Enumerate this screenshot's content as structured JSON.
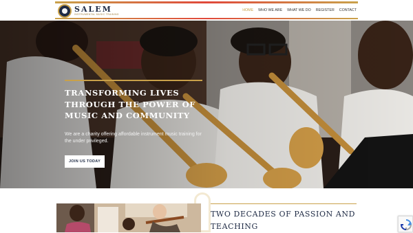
{
  "header": {
    "brand_name": "SALEM",
    "brand_tagline": "INSTRUMENTAL MUSIC TRAINING",
    "nav": [
      {
        "label": "HOME",
        "active": true
      },
      {
        "label": "WHO WE ARE",
        "active": false
      },
      {
        "label": "WHAT WE DO",
        "active": false
      },
      {
        "label": "REGISTER",
        "active": false
      },
      {
        "label": "CONTACT",
        "active": false
      }
    ],
    "colors": {
      "accent": "#c9a14a",
      "brand": "#1e2a44",
      "stripe": "#e0483a"
    }
  },
  "hero": {
    "title": "TRANSFORMING LIVES THROUGH THE POWER OF MUSIC AND COMMUNITY",
    "description": "We are a charity offering affordable instrument music training for the under privileged.",
    "cta_label": "JOIN US TODAY"
  },
  "intro": {
    "title": "TWO DECADES OF PASSION AND TEACHING"
  },
  "icons": [
    "logo-emblem",
    "recaptcha-icon"
  ]
}
